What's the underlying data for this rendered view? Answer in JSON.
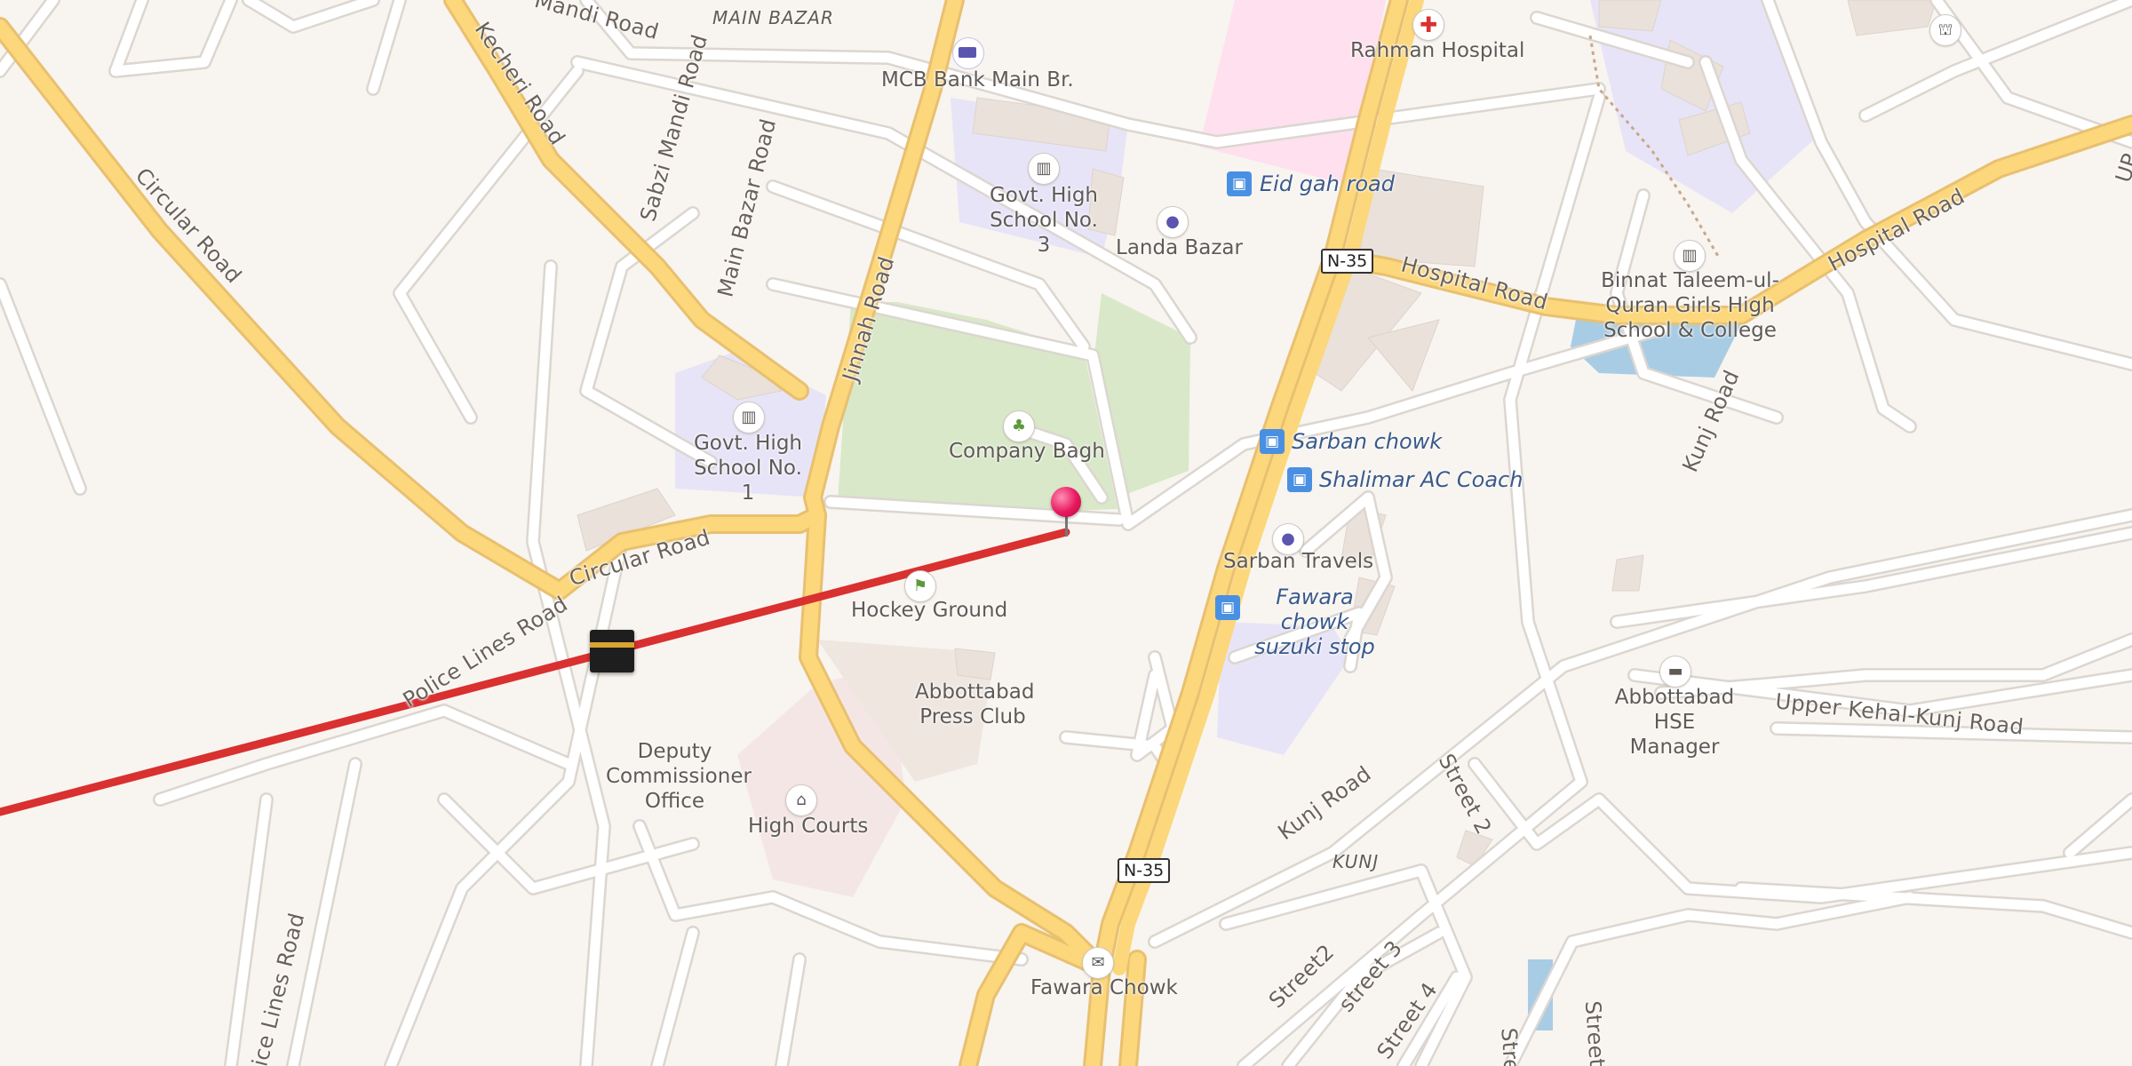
{
  "map": {
    "area_labels": {
      "main_bazar": "MAIN BAZAR",
      "kunj": "KUNJ"
    },
    "roads": {
      "mandi_road": "Mandi Road",
      "kecheri_road": "Kecheri Road",
      "sabzi_mandi_road": "Sabzi Mandi Road",
      "main_bazar_road": "Main Bazar Road",
      "circular_road_nw": "Circular Road",
      "circular_road_s": "Circular Road",
      "jinnah_road": "Jinnah Road",
      "police_lines_road": "Police Lines Road",
      "police_lines_road_2": "ice Lines Road",
      "hospital_road_1": "Hospital Road",
      "hospital_road_2": "Hospital Road",
      "kunj_road_1": "Kunj Road",
      "kunj_road_2": "Kunj Road",
      "upper_kehal": "Upper Kehal-Kunj Road",
      "street_2": "Street 2",
      "street2": "Street2",
      "street_3": "street 3",
      "street_4": "Street 4",
      "stree_a": "Stre",
      "stree_b": "Street",
      "edge_up": "UP"
    },
    "shields": {
      "n35_north": "N-35",
      "n35_south": "N-35"
    },
    "pois": {
      "rahman_hospital": "Rahman Hospital",
      "mcb_bank": "MCB Bank Main Br.",
      "govt_school_3": "Govt. High School No. 3",
      "landa_bazar": "Landa Bazar",
      "company_bagh": "Company Bagh",
      "govt_school_1": "Govt. High School No. 1",
      "hockey_ground": "Hockey Ground",
      "press_club": "Abbottabad Press Club",
      "dc_office": "Deputy Commissioner Office",
      "high_courts": "High Courts",
      "sarban_travels": "Sarban Travels",
      "binnat": "Binnat Taleem-ul-Quran Girls High School & College",
      "hse_manager": "Abbottabad HSE Manager",
      "fawara_chowk": "Fawara Chowk"
    },
    "transit": {
      "eid_gah": "Eid gah road",
      "sarban_chowk": "Sarban chowk",
      "shalimar": "Shalimar AC Coach",
      "fawara_suzuki": "Fawara chowk suzuki stop"
    },
    "icons": {
      "hospital": "hospital-cross-icon",
      "bank": "bank-note-icon",
      "school": "school-icon",
      "shopping": "shopping-bag-icon",
      "park": "tree-icon",
      "sports": "sports-field-icon",
      "courthouse": "courthouse-icon",
      "bus": "bus-stop-icon",
      "hotel": "bed-icon",
      "post": "post-office-icon",
      "mosque": "mosque-icon",
      "pin": "location-pin-icon",
      "qibla": "kaaba-icon"
    },
    "colors": {
      "background": "#f8f4f0",
      "major_road": "#fcd77b",
      "minor_road": "#ffffff",
      "park": "#d8e8c8",
      "school_area": "#e8e4f8",
      "hospital_area": "#ffe0ee",
      "water": "#a8cce4",
      "qibla_line": "#d93030",
      "pin": "#e8175d",
      "transit": "#3a5a8a"
    }
  }
}
